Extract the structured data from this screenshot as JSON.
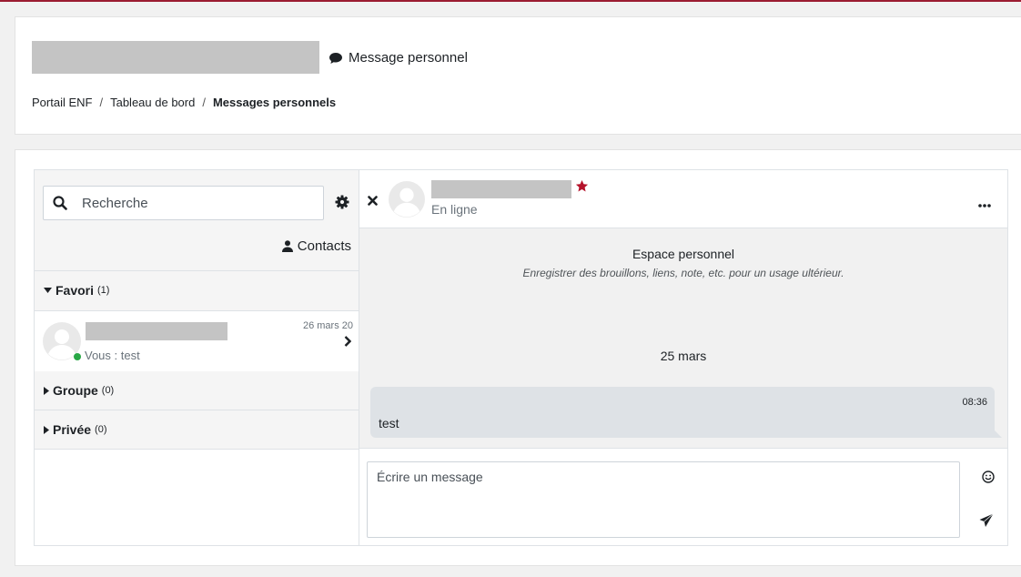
{
  "header": {
    "message_link": "Message personnel",
    "breadcrumb": [
      "Portail ENF",
      "Tableau de bord",
      "Messages personnels"
    ],
    "breadcrumb_sep": "/"
  },
  "sidebar": {
    "search_placeholder": "Recherche",
    "contacts_label": "Contacts",
    "sections": [
      {
        "title": "Favori",
        "count": "(1)",
        "expanded": true
      },
      {
        "title": "Groupe",
        "count": "(0)",
        "expanded": false
      },
      {
        "title": "Privée",
        "count": "(0)",
        "expanded": false
      }
    ],
    "favorite_item": {
      "last_message": "Vous : test",
      "date": "26 mars 20",
      "online": true
    }
  },
  "conversation": {
    "status": "En ligne",
    "personal_space_title": "Espace personnel",
    "personal_space_subtitle": "Enregistrer des brouillons, liens, note, etc. pour un usage ultérieur.",
    "day_label": "25 mars",
    "messages": [
      {
        "time": "08:36",
        "text": "test"
      }
    ],
    "composer_placeholder": "Écrire un message"
  },
  "colors": {
    "brand_red": "#9b1c31",
    "online_green": "#28a745",
    "bubble_bg": "#dee2e6"
  }
}
